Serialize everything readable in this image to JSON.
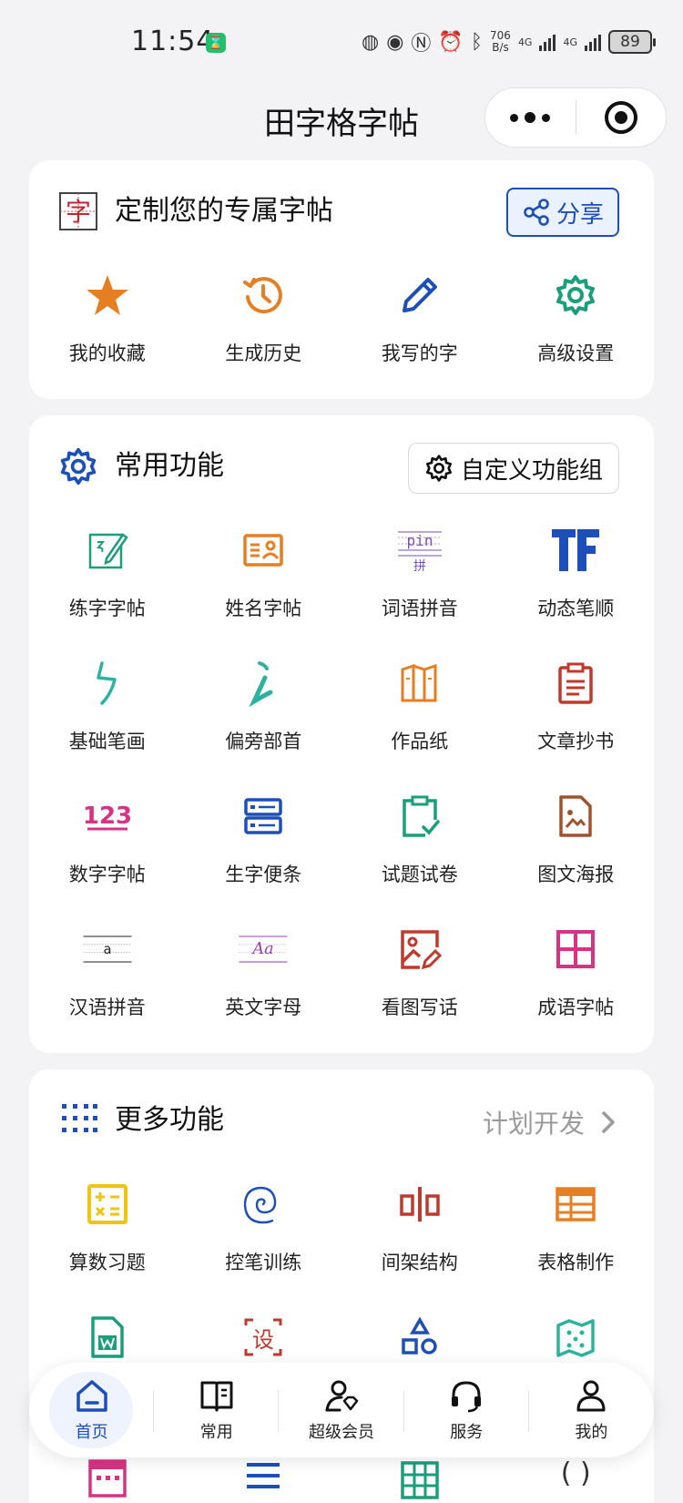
{
  "status_bar": {
    "time": "11:54",
    "speed_top": "706",
    "speed_bottom": "B/s",
    "net1": "4G",
    "net2": "4G",
    "battery": "89"
  },
  "navbar": {
    "title": "田字格字帖"
  },
  "custom_card": {
    "title": "定制您的专属字帖",
    "logo_char": "字",
    "share_label": "分享",
    "items": [
      {
        "label": "我的收藏",
        "icon": "star-icon",
        "color": "#e67e22"
      },
      {
        "label": "生成历史",
        "icon": "history-icon",
        "color": "#e67e22"
      },
      {
        "label": "我写的字",
        "icon": "pencil-icon",
        "color": "#1c4fb8"
      },
      {
        "label": "高级设置",
        "icon": "gear-icon",
        "color": "#1a9e7c"
      }
    ]
  },
  "common_card": {
    "title": "常用功能",
    "custom_group_label": "自定义功能组",
    "items": [
      {
        "label": "练字字帖",
        "icon": "practice-icon"
      },
      {
        "label": "姓名字帖",
        "icon": "name-card-icon"
      },
      {
        "label": "词语拼音",
        "icon": "pinyin-word-icon",
        "pin_text": "pin",
        "han_text": "拼"
      },
      {
        "label": "动态笔顺",
        "icon": "stroke-order-icon"
      },
      {
        "label": "基础笔画",
        "icon": "basic-stroke-icon"
      },
      {
        "label": "偏旁部首",
        "icon": "radical-icon"
      },
      {
        "label": "作品纸",
        "icon": "work-paper-icon"
      },
      {
        "label": "文章抄书",
        "icon": "clipboard-text-icon"
      },
      {
        "label": "数字字帖",
        "icon": "numbers-icon",
        "num_text": "123"
      },
      {
        "label": "生字便条",
        "icon": "note-strip-icon"
      },
      {
        "label": "试题试卷",
        "icon": "exam-icon"
      },
      {
        "label": "图文海报",
        "icon": "poster-icon"
      },
      {
        "label": "汉语拼音",
        "icon": "pinyin-lines-icon",
        "letter": "a"
      },
      {
        "label": "英文字母",
        "icon": "english-letters-icon",
        "letter": "Aa"
      },
      {
        "label": "看图写话",
        "icon": "picture-write-icon"
      },
      {
        "label": "成语字帖",
        "icon": "idiom-grid-icon"
      }
    ]
  },
  "more_card": {
    "title": "更多功能",
    "plan_label": "计划开发",
    "items": [
      {
        "label": "算数习题",
        "icon": "calculator-icon"
      },
      {
        "label": "控笔训练",
        "icon": "spiral-icon"
      },
      {
        "label": "间架结构",
        "icon": "structure-icon"
      },
      {
        "label": "表格制作",
        "icon": "table-icon"
      }
    ]
  },
  "tabbar": {
    "tabs": [
      {
        "label": "首页",
        "icon": "home-icon"
      },
      {
        "label": "常用",
        "icon": "book-icon"
      },
      {
        "label": "超级会员",
        "icon": "vip-user-icon"
      },
      {
        "label": "服务",
        "icon": "headset-icon"
      },
      {
        "label": "我的",
        "icon": "user-icon"
      }
    ]
  }
}
